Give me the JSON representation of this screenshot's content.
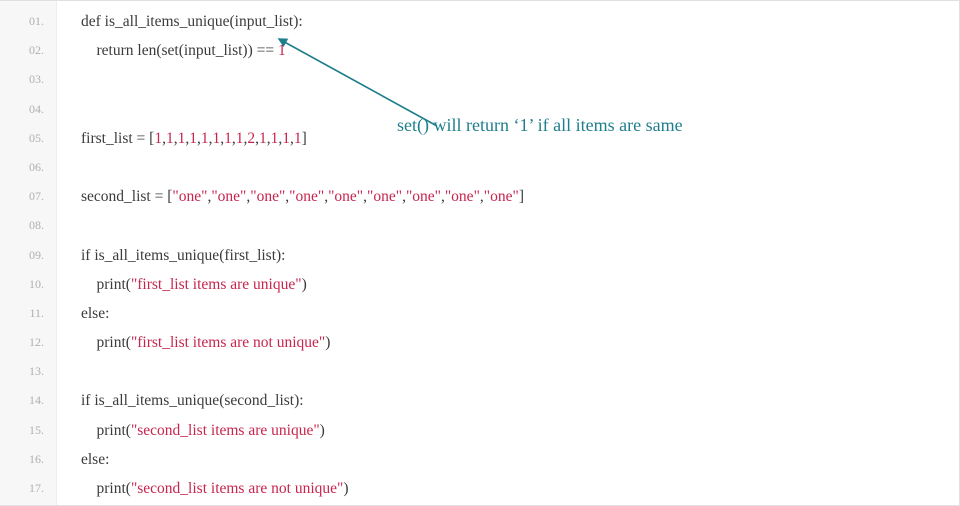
{
  "lines": [
    {
      "n": "01.",
      "tokens": [
        [
          "plain",
          "def is_all_items_unique(input_list):"
        ]
      ]
    },
    {
      "n": "02.",
      "tokens": [
        [
          "plain",
          "    return len(set(input_list)) == "
        ],
        [
          "num",
          "1"
        ]
      ]
    },
    {
      "n": "03.",
      "tokens": []
    },
    {
      "n": "04.",
      "tokens": []
    },
    {
      "n": "05.",
      "tokens": [
        [
          "plain",
          "first_list = ["
        ],
        [
          "num",
          "1"
        ],
        [
          "plain",
          ","
        ],
        [
          "num",
          "1"
        ],
        [
          "plain",
          ","
        ],
        [
          "num",
          "1"
        ],
        [
          "plain",
          ","
        ],
        [
          "num",
          "1"
        ],
        [
          "plain",
          ","
        ],
        [
          "num",
          "1"
        ],
        [
          "plain",
          ","
        ],
        [
          "num",
          "1"
        ],
        [
          "plain",
          ","
        ],
        [
          "num",
          "1"
        ],
        [
          "plain",
          ","
        ],
        [
          "num",
          "1"
        ],
        [
          "plain",
          ","
        ],
        [
          "num",
          "2"
        ],
        [
          "plain",
          ","
        ],
        [
          "num",
          "1"
        ],
        [
          "plain",
          ","
        ],
        [
          "num",
          "1"
        ],
        [
          "plain",
          ","
        ],
        [
          "num",
          "1"
        ],
        [
          "plain",
          ","
        ],
        [
          "num",
          "1"
        ],
        [
          "plain",
          "]"
        ]
      ]
    },
    {
      "n": "06.",
      "tokens": []
    },
    {
      "n": "07.",
      "tokens": [
        [
          "plain",
          "second_list = ["
        ],
        [
          "str",
          "\"one\""
        ],
        [
          "plain",
          ","
        ],
        [
          "str",
          "\"one\""
        ],
        [
          "plain",
          ","
        ],
        [
          "str",
          "\"one\""
        ],
        [
          "plain",
          ","
        ],
        [
          "str",
          "\"one\""
        ],
        [
          "plain",
          ","
        ],
        [
          "str",
          "\"one\""
        ],
        [
          "plain",
          ","
        ],
        [
          "str",
          "\"one\""
        ],
        [
          "plain",
          ","
        ],
        [
          "str",
          "\"one\""
        ],
        [
          "plain",
          ","
        ],
        [
          "str",
          "\"one\""
        ],
        [
          "plain",
          ","
        ],
        [
          "str",
          "\"one\""
        ],
        [
          "plain",
          "]"
        ]
      ]
    },
    {
      "n": "08.",
      "tokens": []
    },
    {
      "n": "09.",
      "tokens": [
        [
          "plain",
          "if is_all_items_unique(first_list):"
        ]
      ]
    },
    {
      "n": "10.",
      "tokens": [
        [
          "plain",
          "    print("
        ],
        [
          "str",
          "\"first_list items are unique\""
        ],
        [
          "plain",
          ")"
        ]
      ]
    },
    {
      "n": "11.",
      "tokens": [
        [
          "plain",
          "else:"
        ]
      ]
    },
    {
      "n": "12.",
      "tokens": [
        [
          "plain",
          "    print("
        ],
        [
          "str",
          "\"first_list items are not unique\""
        ],
        [
          "plain",
          ")"
        ]
      ]
    },
    {
      "n": "13.",
      "tokens": []
    },
    {
      "n": "14.",
      "tokens": [
        [
          "plain",
          "if is_all_items_unique(second_list):"
        ]
      ]
    },
    {
      "n": "15.",
      "tokens": [
        [
          "plain",
          "    print("
        ],
        [
          "str",
          "\"second_list items are unique\""
        ],
        [
          "plain",
          ")"
        ]
      ]
    },
    {
      "n": "16.",
      "tokens": [
        [
          "plain",
          "else:"
        ]
      ]
    },
    {
      "n": "17.",
      "tokens": [
        [
          "plain",
          "    print("
        ],
        [
          "str",
          "\"second_list items are not unique\""
        ],
        [
          "plain",
          ")"
        ]
      ]
    }
  ],
  "annotation": {
    "text": "set() will return ‘1’ if all items are same",
    "color": "#1f7e8c"
  }
}
